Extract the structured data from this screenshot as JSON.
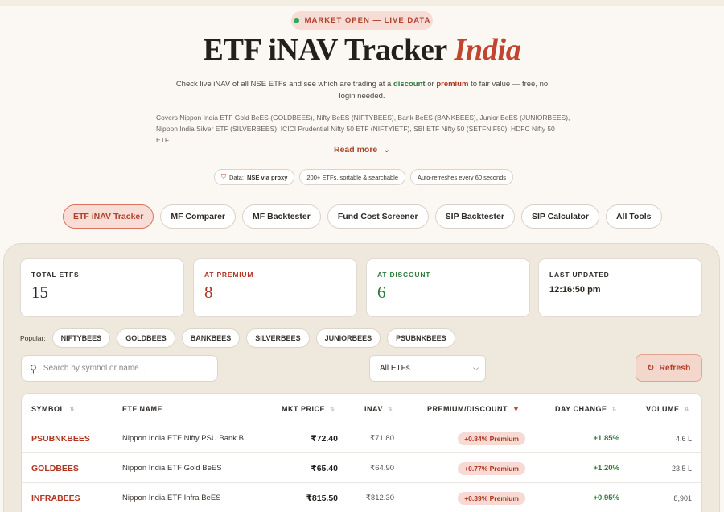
{
  "status_pill": "MARKET OPEN — LIVE DATA",
  "hero": {
    "title_main": "ETF iNAV Tracker ",
    "title_accent": "India"
  },
  "sub": {
    "part1": "Check live iNAV of all NSE ETFs and see which are trading at a ",
    "discount": "discount",
    "or": " or ",
    "premium": "premium",
    "part2": " to fair value — free, no login needed."
  },
  "covers": "Covers Nippon India ETF Gold BeES (GOLDBEES), Nifty BeES (NIFTYBEES), Bank BeES (BANKBEES), Junior BeES (JUNIORBEES), Nippon India Silver ETF (SILVERBEES), ICICI Prudential Nifty 50 ETF (NIFTYIETF), SBI ETF Nifty 50 (SETFNIF50), HDFC Nifty 50 ETF...",
  "read_more": "Read more",
  "badges": {
    "data_label": "Data:",
    "data_value": "NSE via proxy",
    "etfs": "200+ ETFs, sortable & searchable",
    "refresh": "Auto-refreshes every 60 seconds"
  },
  "nav": [
    "ETF iNAV Tracker",
    "MF Comparer",
    "MF Backtester",
    "Fund Cost Screener",
    "SIP Backtester",
    "SIP Calculator",
    "All Tools"
  ],
  "stats": {
    "total": {
      "label": "TOTAL ETFS",
      "value": "15"
    },
    "premium": {
      "label": "AT PREMIUM",
      "value": "8"
    },
    "discount": {
      "label": "AT DISCOUNT",
      "value": "6"
    },
    "updated": {
      "label": "LAST UPDATED",
      "value": "12:16:50 pm"
    }
  },
  "popular": {
    "label": "Popular:",
    "chips": [
      "NIFTYBEES",
      "GOLDBEES",
      "BANKBEES",
      "SILVERBEES",
      "JUNIORBEES",
      "PSUBNKBEES"
    ]
  },
  "search": {
    "placeholder": "Search by symbol or name..."
  },
  "filter": {
    "selected": "All ETFs"
  },
  "refresh_label": "Refresh",
  "table": {
    "headers": {
      "symbol": "SYMBOL",
      "name": "ETF NAME",
      "price": "MKT PRICE",
      "inav": "INAV",
      "premdisc": "PREMIUM/DISCOUNT",
      "change": "DAY CHANGE",
      "volume": "VOLUME"
    },
    "rows": [
      {
        "symbol": "PSUBNKBEES",
        "name": "Nippon India ETF Nifty PSU Bank B...",
        "price": "₹72.40",
        "inav": "₹71.80",
        "premdisc": "+0.84% Premium",
        "change": "+1.85%",
        "volume": "4.6 L"
      },
      {
        "symbol": "GOLDBEES",
        "name": "Nippon India ETF Gold BeES",
        "price": "₹65.40",
        "inav": "₹64.90",
        "premdisc": "+0.77% Premium",
        "change": "+1.20%",
        "volume": "23.5 L"
      },
      {
        "symbol": "INFRABEES",
        "name": "Nippon India ETF Infra BeES",
        "price": "₹815.50",
        "inav": "₹812.30",
        "premdisc": "+0.39% Premium",
        "change": "+0.95%",
        "volume": "8,901"
      }
    ]
  },
  "colors": {
    "accent": "#c0442f",
    "premium": "#b0341f",
    "discount": "#2e7a3b",
    "panel": "#efe8dd"
  }
}
